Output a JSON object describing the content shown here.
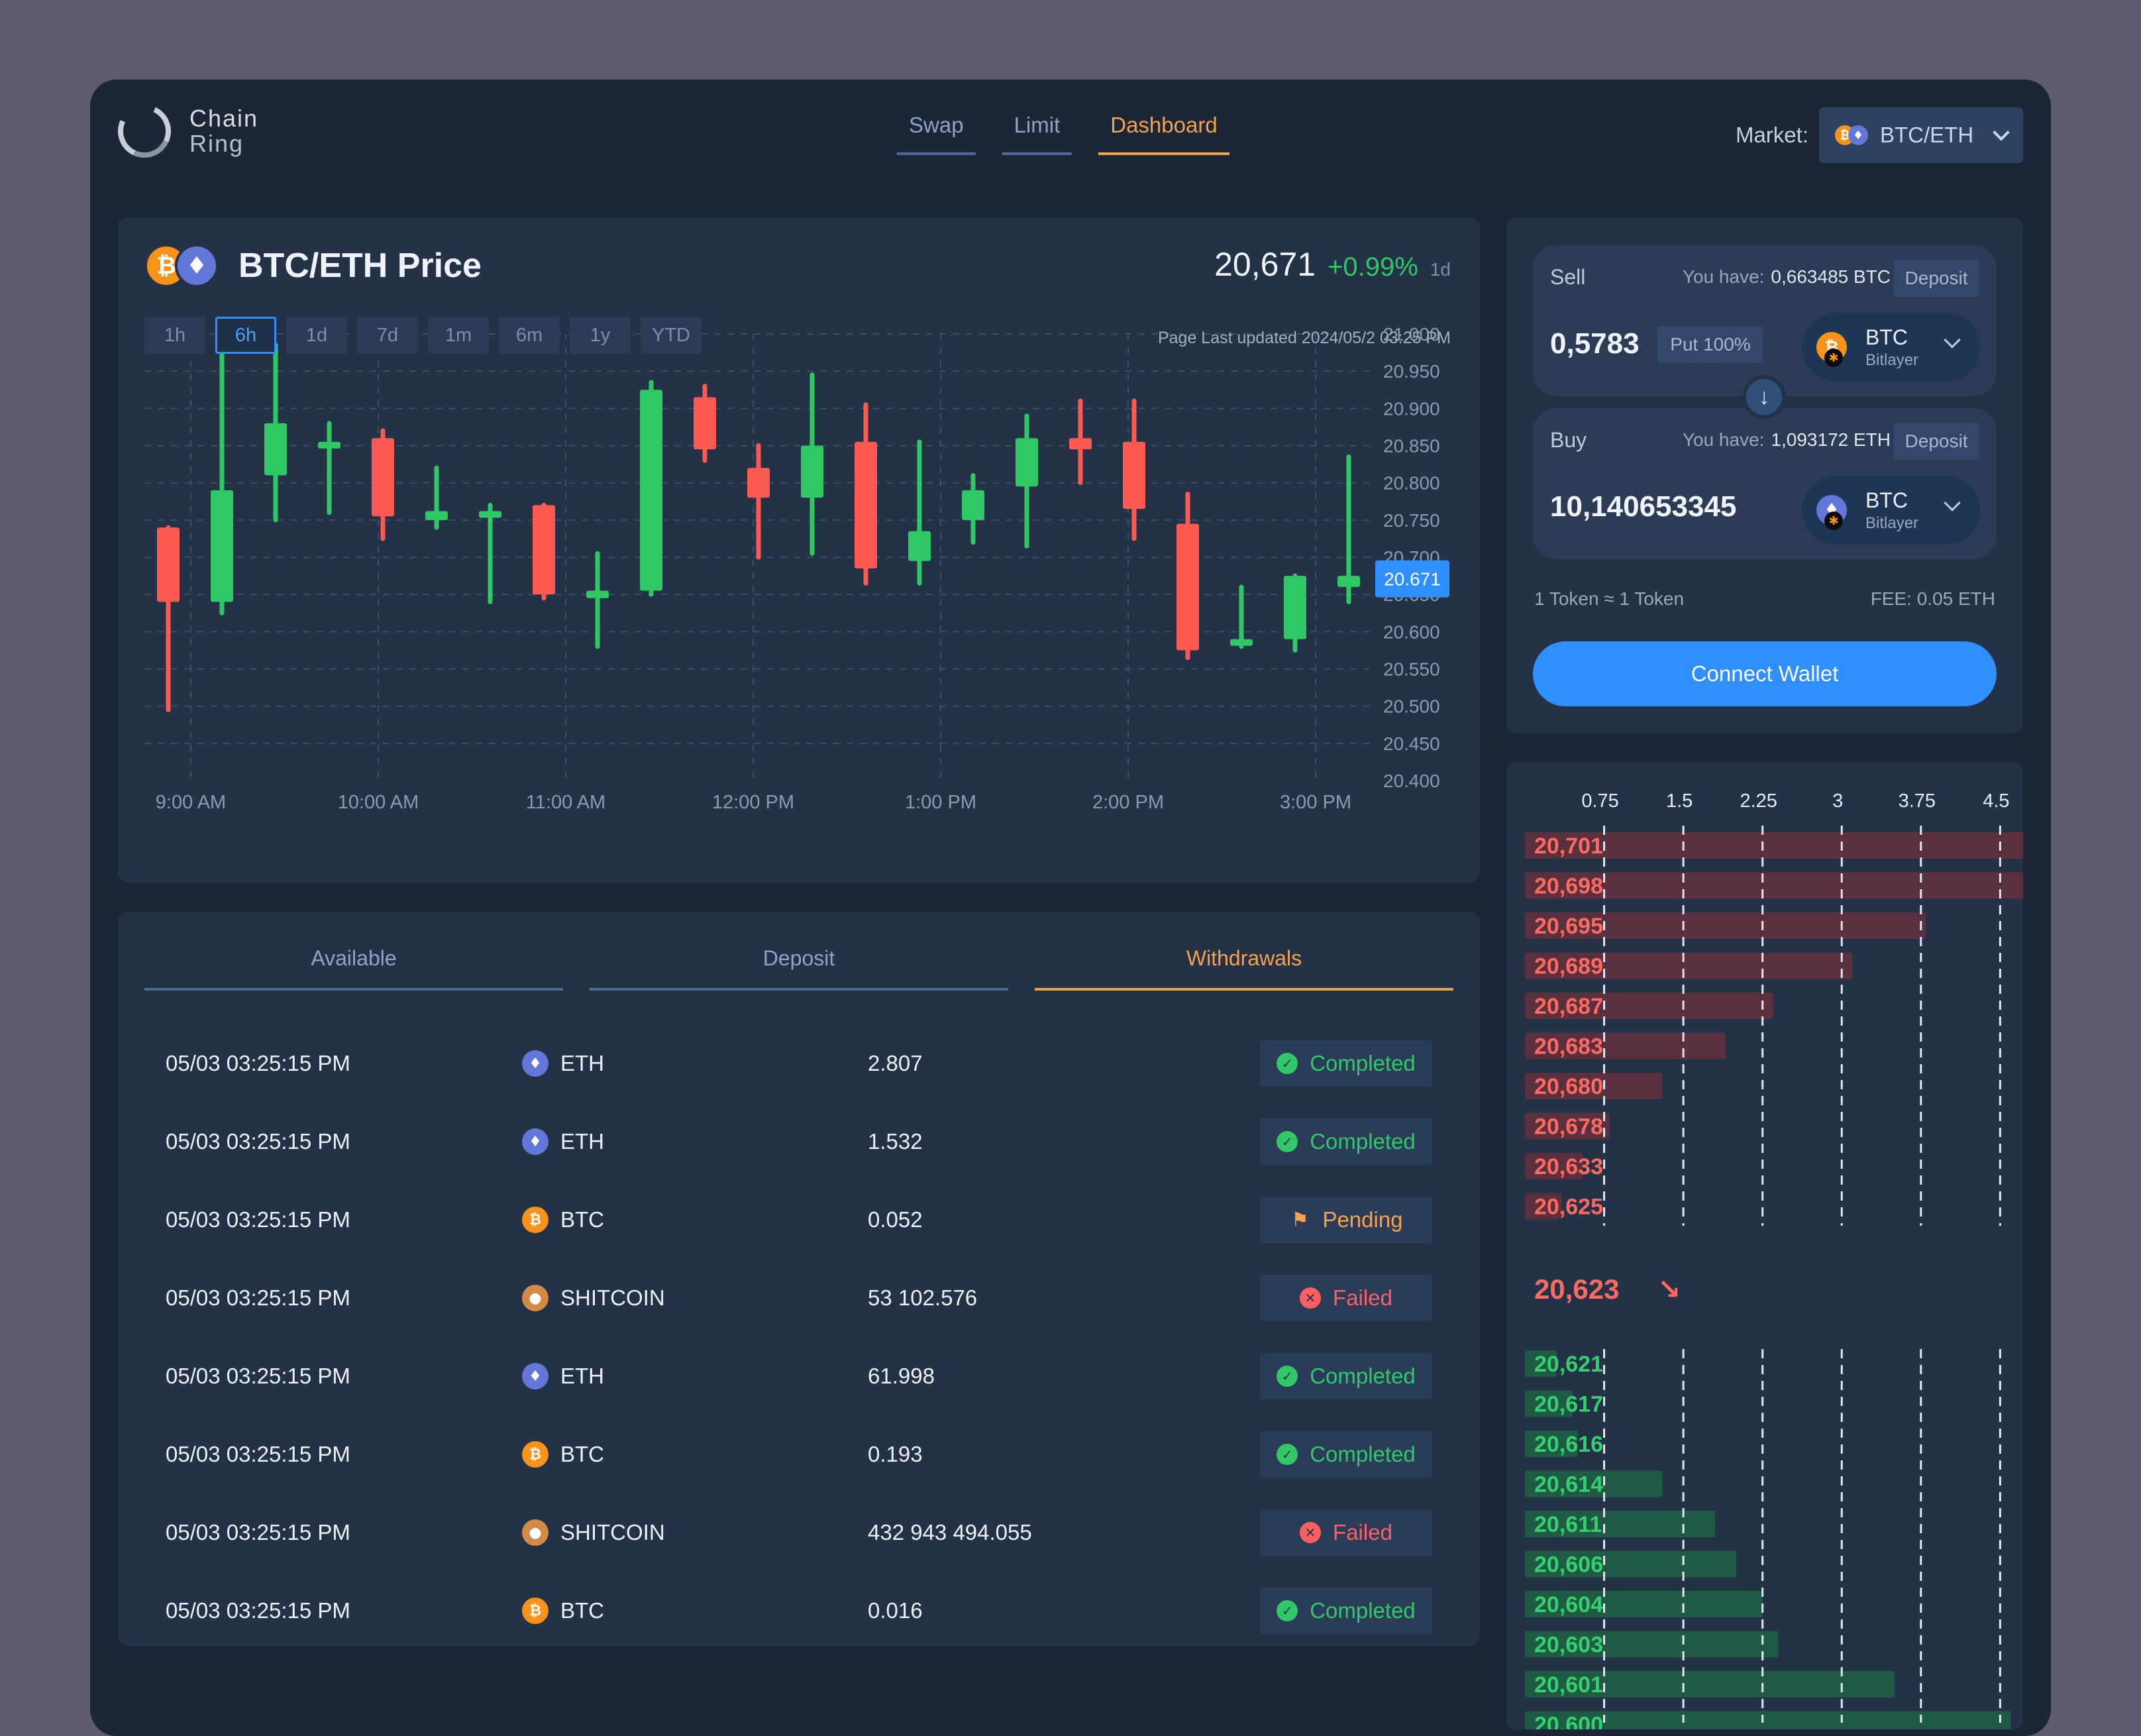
{
  "brand": {
    "name_line1": "Chain",
    "name_line2": "Ring"
  },
  "nav": {
    "tabs": [
      "Swap",
      "Limit",
      "Dashboard"
    ],
    "active": "Dashboard"
  },
  "market": {
    "label": "Market:",
    "pair": "BTC/ETH"
  },
  "price_card": {
    "title": "BTC/ETH  Price",
    "price": "20,671",
    "change": "+0.99%",
    "period": "1d",
    "ranges": [
      "1h",
      "6h",
      "1d",
      "7d",
      "1m",
      "6m",
      "1y",
      "YTD"
    ],
    "active_range": "6h",
    "updated": "Page Last updated 2024/05/2 03:25 PM"
  },
  "chart_data": {
    "type": "candlestick",
    "x_ticks": [
      "9:00 AM",
      "10:00 AM",
      "11:00 AM",
      "12:00 PM",
      "1:00 PM",
      "2:00 PM",
      "3:00 PM"
    ],
    "y_ticks": [
      "21.000",
      "20.950",
      "20.900",
      "20.850",
      "20.800",
      "20.750",
      "20.700",
      "20.650",
      "20.600",
      "20.550",
      "20.500",
      "20.450",
      "20.400"
    ],
    "ylim": [
      20.4,
      21.0
    ],
    "current_price_label": "20.671",
    "current_price": 20.671,
    "colors": {
      "up": "#2fc865",
      "down": "#ff5a52"
    },
    "candles": [
      {
        "o": 20.74,
        "h": 20.74,
        "l": 20.495,
        "c": 20.64
      },
      {
        "o": 20.64,
        "h": 20.99,
        "l": 20.625,
        "c": 20.79
      },
      {
        "o": 20.81,
        "h": 20.985,
        "l": 20.75,
        "c": 20.88
      },
      {
        "o": 20.855,
        "h": 20.88,
        "l": 20.76,
        "c": 20.855
      },
      {
        "o": 20.86,
        "h": 20.87,
        "l": 20.725,
        "c": 20.755
      },
      {
        "o": 20.75,
        "h": 20.82,
        "l": 20.74,
        "c": 20.762
      },
      {
        "o": 20.76,
        "h": 20.77,
        "l": 20.64,
        "c": 20.762
      },
      {
        "o": 20.77,
        "h": 20.77,
        "l": 20.645,
        "c": 20.65
      },
      {
        "o": 20.645,
        "h": 20.705,
        "l": 20.58,
        "c": 20.655
      },
      {
        "o": 20.655,
        "h": 20.935,
        "l": 20.65,
        "c": 20.925
      },
      {
        "o": 20.915,
        "h": 20.93,
        "l": 20.83,
        "c": 20.845
      },
      {
        "o": 20.82,
        "h": 20.85,
        "l": 20.7,
        "c": 20.78
      },
      {
        "o": 20.78,
        "h": 20.945,
        "l": 20.705,
        "c": 20.85
      },
      {
        "o": 20.855,
        "h": 20.905,
        "l": 20.665,
        "c": 20.685
      },
      {
        "o": 20.695,
        "h": 20.855,
        "l": 20.665,
        "c": 20.735
      },
      {
        "o": 20.75,
        "h": 20.81,
        "l": 20.72,
        "c": 20.79
      },
      {
        "o": 20.795,
        "h": 20.89,
        "l": 20.715,
        "c": 20.86
      },
      {
        "o": 20.86,
        "h": 20.91,
        "l": 20.8,
        "c": 20.845
      },
      {
        "o": 20.855,
        "h": 20.91,
        "l": 20.725,
        "c": 20.765
      },
      {
        "o": 20.745,
        "h": 20.785,
        "l": 20.565,
        "c": 20.575
      },
      {
        "o": 20.585,
        "h": 20.66,
        "l": 20.58,
        "c": 20.59
      },
      {
        "o": 20.59,
        "h": 20.675,
        "l": 20.575,
        "c": 20.675
      },
      {
        "o": 20.66,
        "h": 20.835,
        "l": 20.64,
        "c": 20.675
      }
    ]
  },
  "swap": {
    "sell": {
      "label": "Sell",
      "have_label": "You have:",
      "have_value": "0,663485 BTC",
      "deposit": "Deposit",
      "amount": "0,5783",
      "put_all": "Put 100%",
      "token": "BTC",
      "network": "Bitlayer"
    },
    "buy": {
      "label": "Buy",
      "have_label": "You have:",
      "have_value": "1,093172 ETH",
      "deposit": "Deposit",
      "amount": "10,140653345",
      "token": "BTC",
      "network": "Bitlayer"
    },
    "rate": "1 Token ≈ 1 Token",
    "fee": "FEE: 0.05 ETH",
    "connect": "Connect Wallet"
  },
  "orderbook": {
    "scale_ticks": [
      "0.75",
      "1.5",
      "2.25",
      "3",
      "3.75",
      "4.5"
    ],
    "scale_max": 5.25,
    "asks": [
      {
        "price": "20,701",
        "size": 5.3
      },
      {
        "price": "20,698",
        "size": 4.85
      },
      {
        "price": "20,695",
        "size": 3.8
      },
      {
        "price": "20,689",
        "size": 3.1
      },
      {
        "price": "20,687",
        "size": 2.35
      },
      {
        "price": "20,683",
        "size": 1.9
      },
      {
        "price": "20,680",
        "size": 1.3
      },
      {
        "price": "20,678",
        "size": 0.8
      },
      {
        "price": "20,633",
        "size": 0.55
      },
      {
        "price": "20,625",
        "size": 0.35
      }
    ],
    "mid": {
      "price": "20,623",
      "arrow": "↘"
    },
    "bids": [
      {
        "price": "20,621",
        "size": 0.3
      },
      {
        "price": "20,617",
        "size": 0.45
      },
      {
        "price": "20,616",
        "size": 0.5
      },
      {
        "price": "20,614",
        "size": 1.3
      },
      {
        "price": "20,611",
        "size": 1.8
      },
      {
        "price": "20,606",
        "size": 2.0
      },
      {
        "price": "20,604",
        "size": 2.25
      },
      {
        "price": "20,603",
        "size": 2.4
      },
      {
        "price": "20,601",
        "size": 3.5
      },
      {
        "price": "20,600",
        "size": 4.6
      }
    ],
    "colors": {
      "ask_bar": "#5a2f3e",
      "bid_bar": "#1f5a45",
      "ask_text": "#ff6a60",
      "bid_text": "#35cf6d"
    }
  },
  "transactions": {
    "tabs": [
      "Available",
      "Deposit",
      "Withdrawals"
    ],
    "active_tab": "Withdrawals",
    "rows": [
      {
        "date": "05/03  03:25:15 PM",
        "asset": "ETH",
        "amount": "2.807",
        "status": "Completed"
      },
      {
        "date": "05/03  03:25:15 PM",
        "asset": "ETH",
        "amount": "1.532",
        "status": "Completed"
      },
      {
        "date": "05/03  03:25:15 PM",
        "asset": "BTC",
        "amount": "0.052",
        "status": "Pending"
      },
      {
        "date": "05/03  03:25:15 PM",
        "asset": "SHITCOIN",
        "amount": "53 102.576",
        "status": "Failed"
      },
      {
        "date": "05/03  03:25:15 PM",
        "asset": "ETH",
        "amount": "61.998",
        "status": "Completed"
      },
      {
        "date": "05/03  03:25:15 PM",
        "asset": "BTC",
        "amount": "0.193",
        "status": "Completed"
      },
      {
        "date": "05/03  03:25:15 PM",
        "asset": "SHITCOIN",
        "amount": "432 943 494.055",
        "status": "Failed"
      },
      {
        "date": "05/03  03:25:15 PM",
        "asset": "BTC",
        "amount": "0.016",
        "status": "Completed"
      }
    ]
  }
}
